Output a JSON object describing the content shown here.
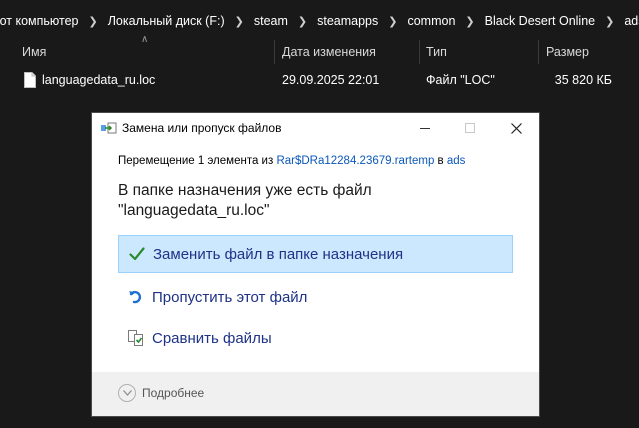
{
  "breadcrumb": {
    "items": [
      "тот компьютер",
      "Локальный диск (F:)",
      "steam",
      "steamapps",
      "common",
      "Black Desert Online",
      "ads"
    ]
  },
  "columns": {
    "name": "Имя",
    "date": "Дата изменения",
    "type": "Тип",
    "size": "Размер"
  },
  "files": [
    {
      "name": "languagedata_ru.loc",
      "date": "29.09.2025 22:01",
      "type": "Файл \"LOC\"",
      "size": "35 820 КБ"
    }
  ],
  "dialog": {
    "title": "Замена или пропуск файлов",
    "subtitle_prefix": "Перемещение 1 элемента из ",
    "source_link": "Rar$DRa12284.23679.rartemp",
    "subtitle_middle": " в ",
    "dest_link": "ads",
    "headline_line1": "В папке назначения уже есть файл",
    "headline_line2": "\"languagedata_ru.loc\"",
    "options": {
      "replace": "Заменить файл в папке назначения",
      "skip": "Пропустить этот файл",
      "compare": "Сравнить файлы"
    },
    "details_label": "Подробнее"
  },
  "colors": {
    "explorer_bg": "#191919",
    "dialog_bg": "#ffffff",
    "option_text": "#1e3287",
    "link": "#0a57b8",
    "selected_bg": "#cce8ff",
    "selected_border": "#99d1ff",
    "check_green": "#2a8a2a"
  }
}
